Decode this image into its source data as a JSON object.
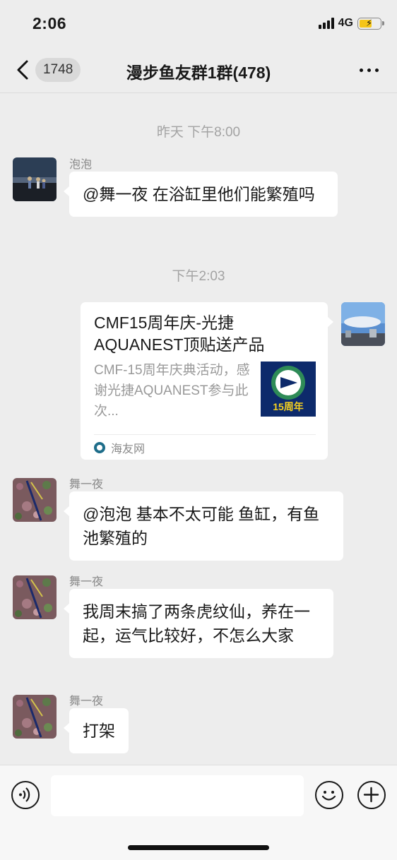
{
  "status_bar": {
    "time": "2:06",
    "network": "4G",
    "signal_icon": "signal-bars-icon",
    "battery_icon": "battery-charging-icon"
  },
  "nav": {
    "back_icon": "chevron-left-icon",
    "unread_count": "1748",
    "title": "漫步鱼友群1群(478)",
    "more_icon": "more-dots-icon"
  },
  "messages": [
    {
      "type": "timestamp",
      "text": "昨天 下午8:00"
    },
    {
      "type": "text",
      "side": "left",
      "sender": "泡泡",
      "text": "@舞一夜 在浴缸里他们能繁殖吗"
    },
    {
      "type": "timestamp",
      "text": "下午2:03"
    },
    {
      "type": "link",
      "side": "right",
      "title": "CMF15周年庆-光捷AQUANEST顶贴送产品",
      "description": "CMF-15周年庆典活动，感谢光捷AQUANEST参与此次...",
      "thumb_text": "15周年",
      "source": "海友网"
    },
    {
      "type": "text",
      "side": "left",
      "sender": "舞一夜",
      "text": "@泡泡 基本不太可能 鱼缸，有鱼池繁殖的"
    },
    {
      "type": "text",
      "side": "left",
      "sender": "舞一夜",
      "text": "我周末搞了两条虎纹仙，养在一起，运气比较好，不怎么大家"
    },
    {
      "type": "text",
      "side": "left",
      "sender": "舞一夜",
      "text": "打架"
    }
  ],
  "input_bar": {
    "voice_icon": "voice-icon",
    "emoji_icon": "emoji-icon",
    "plus_icon": "plus-icon"
  },
  "colors": {
    "background": "#ededed",
    "bubble": "#ffffff",
    "timestamp": "#a3a3a3",
    "battery": "#f5c518"
  }
}
